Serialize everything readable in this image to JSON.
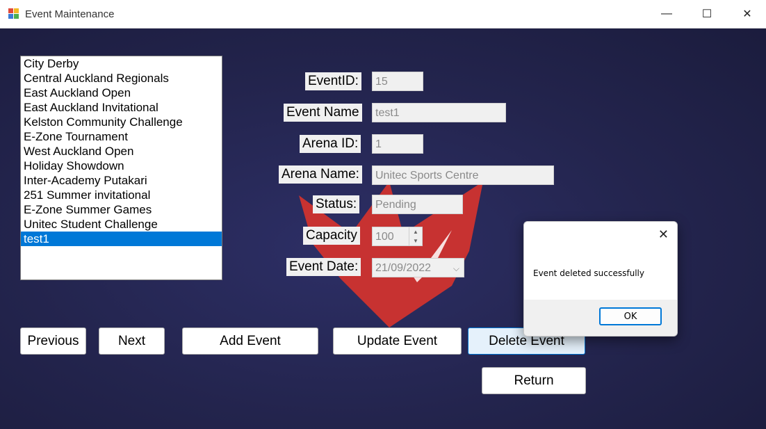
{
  "window": {
    "title": "Event Maintenance",
    "minimize_glyph": "—",
    "maximize_glyph": "☐",
    "close_glyph": "✕"
  },
  "events_list": {
    "items": [
      "City Derby",
      "Central Auckland Regionals",
      "East Auckland Open",
      "East Auckland Invitational",
      "Kelston Community Challenge",
      "E-Zone Tournament",
      "West Auckland Open",
      "Holiday Showdown",
      "Inter-Academy Putakari",
      "251 Summer invitational",
      "E-Zone Summer Games",
      "Unitec Student Challenge",
      "test1"
    ],
    "selected_index": 12
  },
  "form": {
    "event_id": {
      "label": "EventID:",
      "value": "15"
    },
    "event_name": {
      "label": "Event Name",
      "value": "test1"
    },
    "arena_id": {
      "label": "Arena ID:",
      "value": "1"
    },
    "arena_name": {
      "label": "Arena Name:",
      "value": "Unitec Sports Centre"
    },
    "status": {
      "label": "Status:",
      "value": "Pending"
    },
    "capacity": {
      "label": "Capacity",
      "value": "100"
    },
    "event_date": {
      "label": "Event Date:",
      "value": "21/09/2022"
    }
  },
  "buttons": {
    "previous": "Previous",
    "next": "Next",
    "add_event": "Add Event",
    "update_event": "Update Event",
    "delete_event": "Delete Event",
    "return": "Return"
  },
  "dialog": {
    "message": "Event deleted successfully",
    "ok_label": "OK",
    "close_glyph": "✕"
  },
  "colors": {
    "background": "#23244d",
    "selection": "#0078d7",
    "logo_red": "#d8332c"
  }
}
